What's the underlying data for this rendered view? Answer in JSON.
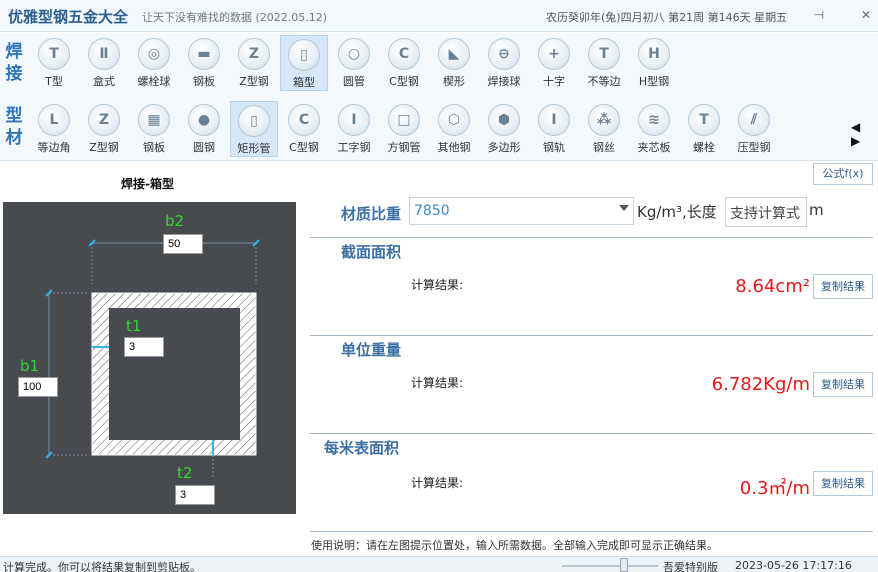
{
  "titlebar": {
    "app_title": "优雅型钢五金大全",
    "slogan": "让天下没有难找的数据 (2022.05.12)",
    "date_info": "农历癸卯年(兔)四月初八 第21周 第146天 星期五",
    "pin_icon": "⊣",
    "close_icon": "✕"
  },
  "weld_row": {
    "category": "焊接",
    "items": [
      {
        "label": "T型",
        "glyph": "T"
      },
      {
        "label": "盒式",
        "glyph": "Ⅱ"
      },
      {
        "label": "螺栓球",
        "glyph": "◎"
      },
      {
        "label": "钢板",
        "glyph": "▬"
      },
      {
        "label": "Z型钢",
        "glyph": "Z"
      },
      {
        "label": "箱型",
        "glyph": "▯"
      },
      {
        "label": "圆管",
        "glyph": "○"
      },
      {
        "label": "C型钢",
        "glyph": "C"
      },
      {
        "label": "楔形",
        "glyph": "◣"
      },
      {
        "label": "焊接球",
        "glyph": "⊖"
      },
      {
        "label": "十字",
        "glyph": "+"
      },
      {
        "label": "不等边",
        "glyph": "T"
      },
      {
        "label": "H型钢",
        "glyph": "H"
      }
    ]
  },
  "profile_row": {
    "category": "型材",
    "items": [
      {
        "label": "等边角",
        "glyph": "L"
      },
      {
        "label": "Z型钢",
        "glyph": "Z"
      },
      {
        "label": "钢板",
        "glyph": "▦"
      },
      {
        "label": "圆钢",
        "glyph": "●"
      },
      {
        "label": "矩形管",
        "glyph": "▯"
      },
      {
        "label": "C型钢",
        "glyph": "C"
      },
      {
        "label": "工字钢",
        "glyph": "I"
      },
      {
        "label": "方钢管",
        "glyph": "□"
      },
      {
        "label": "其他钢",
        "glyph": "⬡"
      },
      {
        "label": "多边形",
        "glyph": "⬢"
      },
      {
        "label": "钢轨",
        "glyph": "I"
      },
      {
        "label": "钢丝",
        "glyph": "⁂"
      },
      {
        "label": "夹芯板",
        "glyph": "≋"
      },
      {
        "label": "螺栓",
        "glyph": "T"
      },
      {
        "label": "压型钢",
        "glyph": "⫽"
      }
    ]
  },
  "nav_arrows": "◀ ▶",
  "diagram": {
    "title": "焊接-箱型",
    "b2": {
      "label": "b2",
      "value": "50"
    },
    "t1": {
      "label": "t1",
      "value": "3"
    },
    "b1": {
      "label": "b1",
      "value": "100"
    },
    "t2": {
      "label": "t2",
      "value": "3"
    }
  },
  "panel": {
    "formula_button": "公式f(x)",
    "density_label": "材质比重",
    "density_value": "7850",
    "density_unit": "Kg/m³,长度",
    "length_placeholder": "支持计算式",
    "length_unit": "m",
    "area_title": "截面面积",
    "area_calc_label": "计算结果:",
    "area_result": "8.64cm²",
    "weight_title": "单位重量",
    "weight_calc_label": "计算结果:",
    "weight_result": "6.782Kg/m",
    "surface_title": "每米表面积",
    "surface_calc_label": "计算结果:",
    "surface_result": "0.3㎡/m",
    "copy_label": "复制结果",
    "usage_note": "使用说明：请在左图提示位置处，输入所需数据。全部输入完成即可显示正确结果。"
  },
  "status": {
    "left": "计算完成。你可以将结果复制到剪贴板。",
    "edition": "吾爱特别版",
    "time": "2023-05-26 17:17:16"
  }
}
